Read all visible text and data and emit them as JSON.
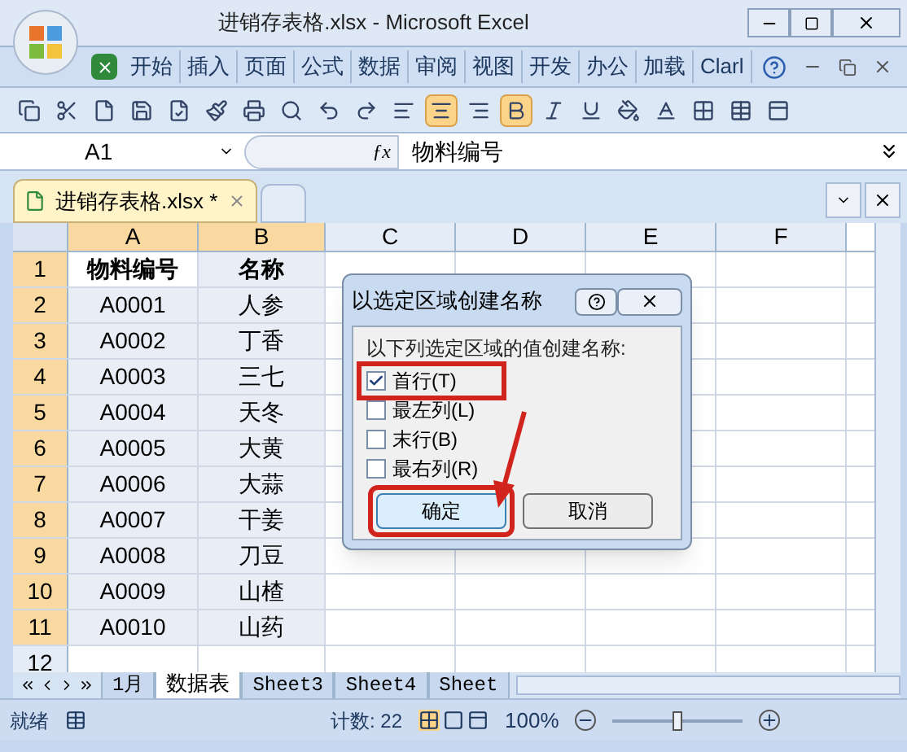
{
  "window": {
    "title": "进销存表格.xlsx - Microsoft Excel"
  },
  "ribbon_tabs": [
    "开始",
    "插入",
    "页面",
    "公式",
    "数据",
    "审阅",
    "视图",
    "开发",
    "办公",
    "加载",
    "Clarl"
  ],
  "toolbar": {
    "align_center_on": true,
    "bold_on": true
  },
  "name_box": "A1",
  "fx_label": "ƒx",
  "formula": "物料编号",
  "doc_tab": {
    "title": "进销存表格.xlsx *"
  },
  "columns": [
    "A",
    "B",
    "C",
    "D",
    "E",
    "F"
  ],
  "rows": [
    {
      "number": "1",
      "cells": [
        "物料编号",
        "名称"
      ]
    },
    {
      "number": "2",
      "cells": [
        "A0001",
        "人参"
      ]
    },
    {
      "number": "3",
      "cells": [
        "A0002",
        "丁香"
      ]
    },
    {
      "number": "4",
      "cells": [
        "A0003",
        "三七"
      ]
    },
    {
      "number": "5",
      "cells": [
        "A0004",
        "天冬"
      ]
    },
    {
      "number": "6",
      "cells": [
        "A0005",
        "大黄"
      ]
    },
    {
      "number": "7",
      "cells": [
        "A0006",
        "大蒜"
      ]
    },
    {
      "number": "8",
      "cells": [
        "A0007",
        "干姜"
      ]
    },
    {
      "number": "9",
      "cells": [
        "A0008",
        "刀豆"
      ]
    },
    {
      "number": "10",
      "cells": [
        "A0009",
        "山楂"
      ]
    },
    {
      "number": "11",
      "cells": [
        "A0010",
        "山药"
      ]
    },
    {
      "number": "12",
      "cells": []
    }
  ],
  "sheet_tabs": [
    {
      "label": "1月",
      "selected": false
    },
    {
      "label": "数据表",
      "selected": true
    },
    {
      "label": "Sheet3",
      "selected": false
    },
    {
      "label": "Sheet4",
      "selected": false
    },
    {
      "label": "Sheet",
      "selected": false
    }
  ],
  "status_bar": {
    "status": "就绪",
    "count": "计数: 22",
    "zoom": "100%",
    "zoom_slider": {
      "level": 0.5
    }
  },
  "dialog": {
    "title": "以选定区域创建名称",
    "group_label": "以下列选定区域的值创建名称:",
    "options": [
      {
        "label": "首行(T)",
        "checked": true,
        "highlighted": true
      },
      {
        "label": "最左列(L)",
        "checked": false,
        "highlighted": false
      },
      {
        "label": "末行(B)",
        "checked": false,
        "highlighted": false
      },
      {
        "label": "最右列(R)",
        "checked": false,
        "highlighted": false
      }
    ],
    "buttons": [
      {
        "label": "确定",
        "default": true,
        "highlighted": true
      },
      {
        "label": "取消",
        "default": false,
        "highlighted": false
      }
    ]
  }
}
